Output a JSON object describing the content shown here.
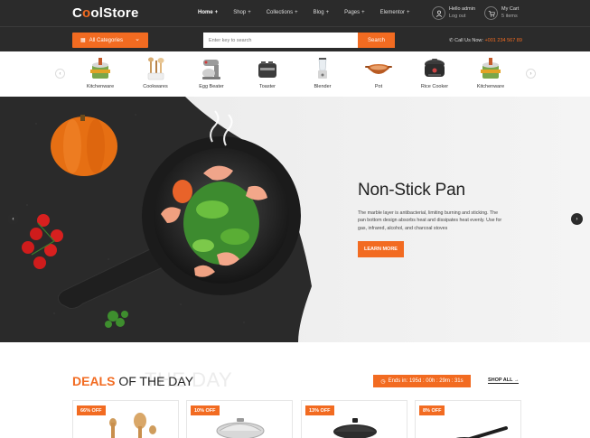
{
  "header": {
    "logo_prefix": "C",
    "logo_mid": "o",
    "logo_rest": "olStore",
    "nav": [
      {
        "label": "Home"
      },
      {
        "label": "Shop"
      },
      {
        "label": "Collections"
      },
      {
        "label": "Blog"
      },
      {
        "label": "Pages"
      },
      {
        "label": "Elementor"
      }
    ],
    "account_greeting": "Hello admin",
    "account_action": "Log out",
    "cart_label": "My Cart",
    "cart_count": "5 items"
  },
  "searchbar": {
    "category_button": "All Categories",
    "placeholder": "Enter key to search",
    "search_button": "Search",
    "call_label": "Call Us Now:",
    "phone": "+001 234 567 89"
  },
  "categories": [
    {
      "label": "Kitchenware",
      "icon": "kitchenware-icon"
    },
    {
      "label": "Cookwares",
      "icon": "cookwares-icon"
    },
    {
      "label": "Egg Beater",
      "icon": "egg-beater-icon"
    },
    {
      "label": "Toaster",
      "icon": "toaster-icon"
    },
    {
      "label": "Blender",
      "icon": "blender-icon"
    },
    {
      "label": "Pot",
      "icon": "pot-icon"
    },
    {
      "label": "Rice Cooker",
      "icon": "rice-cooker-icon"
    },
    {
      "label": "Kitchenware",
      "icon": "kitchenware-icon"
    }
  ],
  "hero": {
    "title": "Non-Stick Pan",
    "description": "The marble layer is antibacterial, limiting burning and sticking. The pan bottom design absorbs heat and dissipates heat evenly. Use for gas, infrared, alcohol, and charcoal stoves",
    "button": "LEARN MORE"
  },
  "deals": {
    "title_highlight": "DEALS",
    "title_rest": "OF THE DAY",
    "ghost_text": "THE DAY",
    "timer": "Ends in: 195d : 00h : 29m : 31s",
    "shop_all": "SHOP ALL",
    "products": [
      {
        "badge": "66% OFF"
      },
      {
        "badge": "10% OFF"
      },
      {
        "badge": "13% OFF"
      },
      {
        "badge": "8% OFF"
      }
    ]
  },
  "colors": {
    "accent": "#f26b21",
    "dark": "#2b2b2b"
  }
}
